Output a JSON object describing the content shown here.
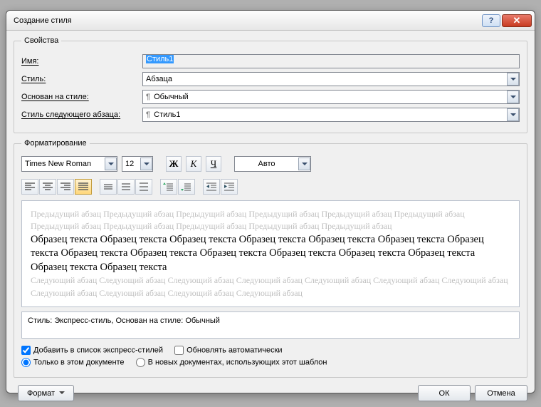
{
  "title": "Создание стиля",
  "group_props": "Свойства",
  "labels": {
    "name": "Имя:",
    "style": "Стиль:",
    "based_on": "Основан на стиле:",
    "next_para": "Стиль следующего абзаца:"
  },
  "values": {
    "name": "Стиль1",
    "style": "Абзаца",
    "based_on": "Обычный",
    "next_para": "Стиль1"
  },
  "group_fmt": "Форматирование",
  "font": "Times New Roman",
  "size": "12",
  "bold": "Ж",
  "italic": "К",
  "uline": "Ч",
  "color": "Авто",
  "preview_prev": "Предыдущий абзац Предыдущий абзац Предыдущий абзац Предыдущий абзац Предыдущий абзац Предыдущий абзац Предыдущий абзац Предыдущий абзац Предыдущий абзац Предыдущий абзац Предыдущий абзац",
  "preview_sample": "Образец текста Образец текста Образец текста Образец текста Образец текста Образец текста Образец текста Образец текста Образец текста Образец текста Образец текста Образец текста Образец текста Образец текста Образец текста",
  "preview_next": "Следующий абзац Следующий абзац Следующий абзац Следующий абзац Следующий абзац Следующий абзац Следующий абзац Следующий абзац Следующий абзац Следующий абзац Следующий абзац",
  "desc": "Стиль: Экспресс-стиль, Основан на стиле: Обычный",
  "opts": {
    "quick": "Добавить в список экспресс-стилей",
    "auto": "Обновлять автоматически",
    "doc": "Только в этом документе",
    "tpl": "В новых документах, использующих этот шаблон"
  },
  "buttons": {
    "format": "Формат",
    "ok": "ОК",
    "cancel": "Отмена"
  }
}
